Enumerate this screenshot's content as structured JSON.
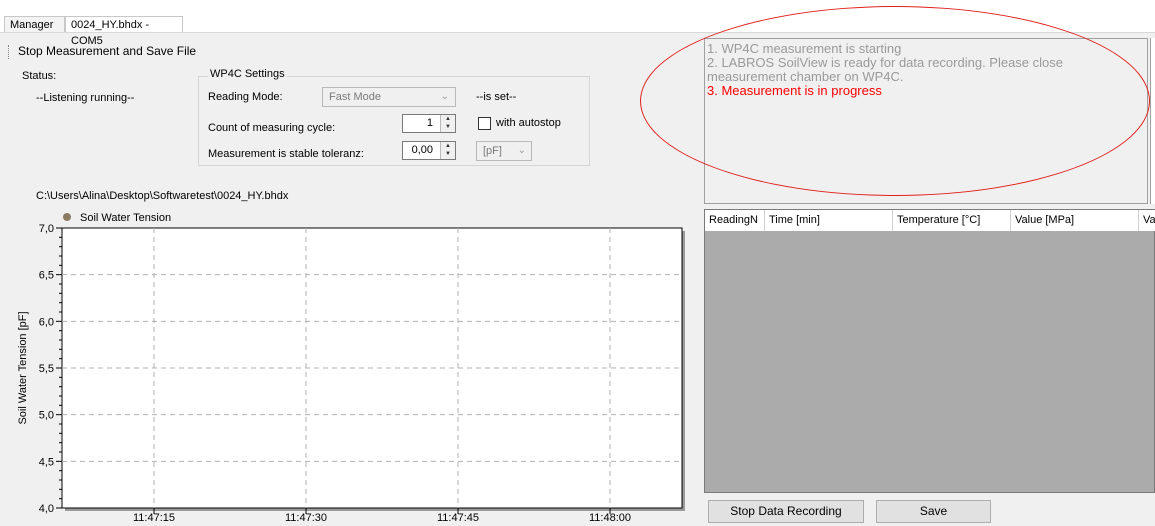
{
  "tabs": [
    {
      "label": "Manager"
    },
    {
      "label": "0024_HY.bhdx - COM5"
    }
  ],
  "toolbar": {
    "stop_save_label": "Stop Measurement and Save File"
  },
  "status": {
    "label": "Status:",
    "value": "--Listening running--"
  },
  "settings": {
    "group_title": "WP4C Settings",
    "reading_mode_label": "Reading Mode:",
    "reading_mode_value": "Fast Mode",
    "is_set": "--is set--",
    "count_label": "Count of measuring cycle:",
    "count_value": "1",
    "autostop_label": "with autostop",
    "tolerance_label": "Measurement is stable toleranz:",
    "tolerance_value": "0,00",
    "unit_value": "[pF]"
  },
  "file_path": "C:\\Users\\Alina\\Desktop\\Softwaretest\\0024_HY.bhdx",
  "messages": [
    {
      "text": "1. WP4C measurement is starting"
    },
    {
      "text": "2. LABROS SoilView is ready for data recording. Please close measurement chamber on WP4C."
    },
    {
      "text": "3. Measurement is in progress"
    }
  ],
  "table": {
    "columns": [
      "ReadingN",
      "Time [min]",
      "Temperature [°C]",
      "Value [MPa]",
      "Va"
    ]
  },
  "buttons": {
    "stop_recording": "Stop Data Recording",
    "save": "Save"
  },
  "colors": {
    "message_active": "#ff0000",
    "message_inactive": "#9a9a9a",
    "annotation_ellipse": "#e0201a",
    "series_marker": "#8c7b63"
  },
  "chart_data": {
    "type": "line",
    "title": "",
    "legend": [
      "Soil Water Tension"
    ],
    "legend_placement": "top-left",
    "ylabel": "Soil Water Tension [pF]",
    "xlabel": "",
    "ylim": [
      4.0,
      7.0
    ],
    "yticks": [
      "7,0",
      "6,5",
      "6,0",
      "5,5",
      "5,0",
      "4,5",
      "4,0"
    ],
    "xticks": [
      "11:47:15",
      "11:47:30",
      "11:47:45",
      "11:48:00"
    ],
    "grid": true,
    "series": [
      {
        "name": "Soil Water Tension",
        "values": []
      }
    ]
  }
}
